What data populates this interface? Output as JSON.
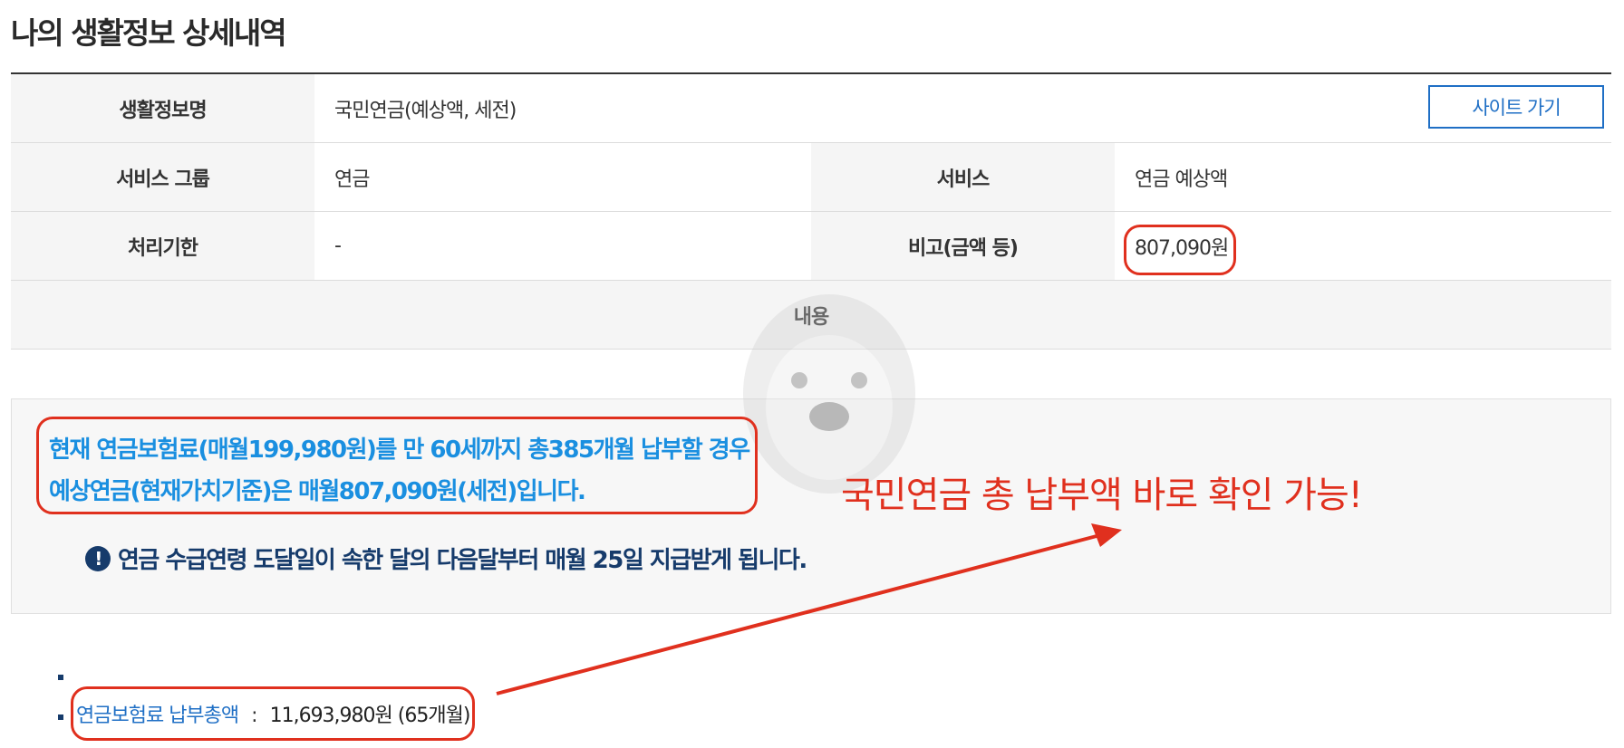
{
  "page_title": "나의 생활정보 상세내역",
  "table": {
    "row1": {
      "label": "생활정보명",
      "value": "국민연금(예상액, 세전)",
      "button": "사이트 가기"
    },
    "row2": {
      "label1": "서비스 그룹",
      "value1": "연금",
      "label2": "서비스",
      "value2": "연금 예상액"
    },
    "row3": {
      "label1": "처리기한",
      "value1": "-",
      "label2": "비고(금액 등)",
      "value2": "807,090원"
    },
    "content_header": "내용"
  },
  "content": {
    "line1": "현재 연금보험료(매월199,980원)를 만 60세까지 총385개월 납부할 경우",
    "line2": "예상연금(현재가치기준)은 매월807,090원(세전)입니다.",
    "notice": "연금 수급연령 도달일이 속한 달의 다음달부터 매월 25일 지급받게 됩니다."
  },
  "annotation_text": "국민연금 총 납부액 바로 확인 가능!",
  "total": {
    "label": "연금보험료 납부총액",
    "separator": ":",
    "value": "11,693,980원 (65개월)"
  },
  "colors": {
    "accent_blue": "#1a8fe0",
    "dark_navy": "#163b6b",
    "highlight_red": "#e0301e",
    "button_blue": "#1f6fc5"
  },
  "icons": {
    "notice": "exclamation-circle-icon",
    "watermark": "dog-face-icon"
  }
}
